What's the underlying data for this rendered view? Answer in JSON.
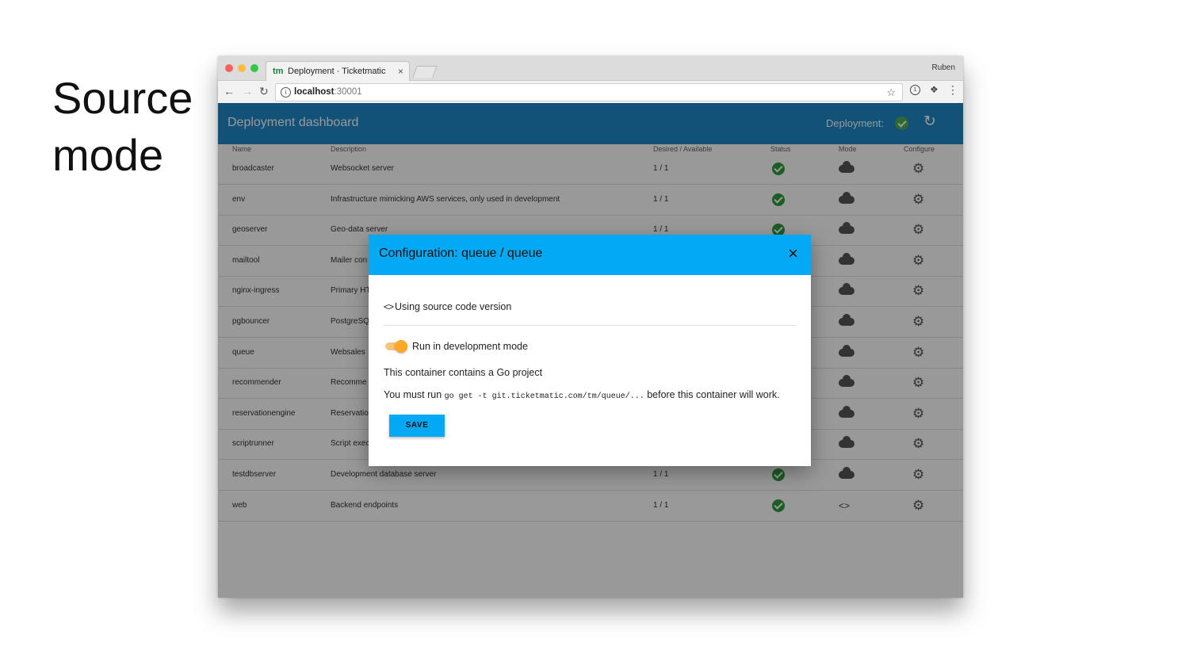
{
  "slide": {
    "title_line1": "Source",
    "title_line2": "mode"
  },
  "browser": {
    "tab_logo": "tm",
    "tab_title": "Deployment · Ticketmatic",
    "tab_close": "×",
    "profile": "Ruben",
    "url_host": "localhost",
    "url_port": ":30001"
  },
  "header": {
    "title": "Deployment dashboard",
    "deployment_label": "Deployment:",
    "deployment_status": "ok",
    "refresh_icon": "refresh-icon"
  },
  "table": {
    "columns": [
      "Name",
      "Description",
      "Desired / Available",
      "Status",
      "Mode",
      "Configure"
    ],
    "rows": [
      {
        "name": "broadcaster",
        "description": "Websocket server",
        "desired_available": "1 / 1",
        "status": "ok",
        "mode": "cloud"
      },
      {
        "name": "env",
        "description": "Infrastructure mimicking AWS services, only used in development",
        "desired_available": "1 / 1",
        "status": "ok",
        "mode": "cloud"
      },
      {
        "name": "geoserver",
        "description": "Geo-data server",
        "desired_available": "1 / 1",
        "status": "ok",
        "mode": "cloud"
      },
      {
        "name": "mailtool",
        "description": "Mailer con",
        "desired_available": "",
        "status": "",
        "mode": "cloud"
      },
      {
        "name": "nginx-ingress",
        "description": "Primary HT",
        "desired_available": "",
        "status": "",
        "mode": "cloud"
      },
      {
        "name": "pgbouncer",
        "description": "PostgreSQ",
        "desired_available": "",
        "status": "",
        "mode": "cloud"
      },
      {
        "name": "queue",
        "description": "Websales",
        "desired_available": "",
        "status": "",
        "mode": "cloud"
      },
      {
        "name": "recommender",
        "description": "Recomme",
        "desired_available": "",
        "status": "",
        "mode": "cloud"
      },
      {
        "name": "reservationengine",
        "description": "Reservatio",
        "desired_available": "",
        "status": "",
        "mode": "cloud"
      },
      {
        "name": "scriptrunner",
        "description": "Script exec",
        "desired_available": "",
        "status": "",
        "mode": "cloud"
      },
      {
        "name": "testdbserver",
        "description": "Development database server",
        "desired_available": "1 / 1",
        "status": "ok",
        "mode": "cloud"
      },
      {
        "name": "web",
        "description": "Backend endpoints",
        "desired_available": "1 / 1",
        "status": "ok",
        "mode": "source",
        "mode_text": "<>"
      }
    ]
  },
  "modal": {
    "title": "Configuration: queue / queue",
    "close": "×",
    "source_icon": "<>",
    "source_label": "Using source code version",
    "toggle_label": "Run in development mode",
    "toggle_on": true,
    "project_text": "This container contains a Go project",
    "must_run_prefix": "You must run ",
    "command": "go get -t git.ticketmatic.com/tm/queue/...",
    "must_run_suffix": " before this container will work.",
    "save_label": "SAVE"
  },
  "colors": {
    "header": "#1e88c8",
    "modal_header": "#03a9f4",
    "status_ok": "#2e9d3f",
    "toggle": "#ffa726"
  }
}
